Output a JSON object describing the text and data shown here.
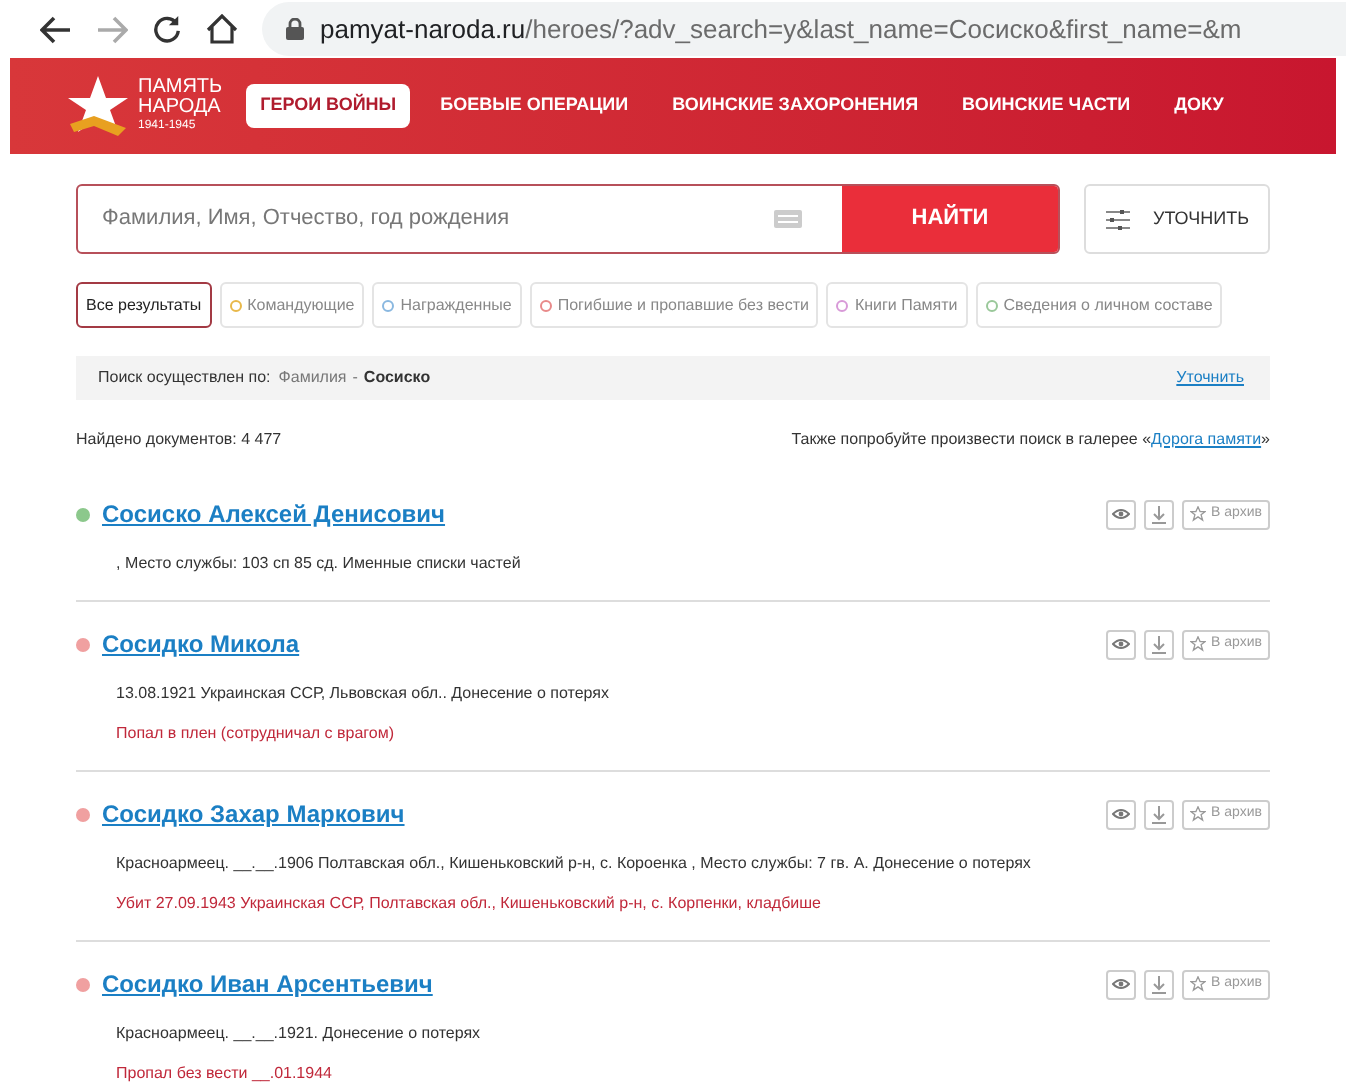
{
  "browser": {
    "url_host": "pamyat-naroda.ru",
    "url_path": "/heroes/?adv_search=y&last_name=Сосиско&first_name=&m"
  },
  "logo": {
    "line1": "ПАМЯТЬ",
    "line2": "НАРОДА",
    "years": "1941-1945"
  },
  "nav": [
    {
      "label": "ГЕРОИ ВОЙНЫ",
      "selected": true
    },
    {
      "label": "БОЕВЫЕ ОПЕРАЦИИ",
      "selected": false
    },
    {
      "label": "ВОИНСКИЕ ЗАХОРОНЕНИЯ",
      "selected": false
    },
    {
      "label": "ВОИНСКИЕ ЧАСТИ",
      "selected": false
    },
    {
      "label": "ДОКУ",
      "selected": false
    }
  ],
  "search": {
    "placeholder": "Фамилия, Имя, Отчество, год рождения",
    "button": "НАЙТИ",
    "refine": "УТОЧНИТЬ"
  },
  "filters": [
    {
      "label": "Все результаты",
      "selected": true
    },
    {
      "label": "Командующие",
      "selected": false,
      "color": "#e8b84a"
    },
    {
      "label": "Награжденные",
      "selected": false,
      "color": "#8ab8e0"
    },
    {
      "label": "Погибшие и пропавшие без вести",
      "selected": false,
      "color": "#e88a8a"
    },
    {
      "label": "Книги Памяти",
      "selected": false,
      "color": "#d89ad8"
    },
    {
      "label": "Сведения о личном составе",
      "selected": false,
      "color": "#9ac89a"
    }
  ],
  "query_bar": {
    "label": "Поиск осуществлен по:",
    "field": "Фамилия",
    "separator": "-",
    "value": "Сосиско",
    "link": "Уточнить"
  },
  "found": "Найдено документов: 4 477",
  "gallery_hint": {
    "text": "Также попробуйте произвести поиск в галерее «",
    "link": "Дорога памяти",
    "close": "»"
  },
  "results": [
    {
      "name": "Сосиско Алексей Денисович",
      "color": "#8cc88c",
      "details": ", Место службы: 103 сп 85 сд. Именные списки частей",
      "archive": "В архив"
    },
    {
      "name": "Сосидко Микола",
      "color": "#f0a0a0",
      "details": "13.08.1921 Украинская ССР, Львовская обл.. Донесение о потерях",
      "status": "Попал в плен (сотрудничал с врагом)",
      "archive": "В архив"
    },
    {
      "name": "Сосидко Захар Маркович",
      "color": "#f0a0a0",
      "details": "Красноармеец. __.__.1906 Полтавская обл., Кишеньковский р-н, с. Короенка , Место службы: 7 гв. А. Донесение о потерях",
      "status": "Убит 27.09.1943 Украинская ССР, Полтавская обл., Кишеньковский р-н, с. Корпенки, кладбише",
      "archive": "В архив"
    },
    {
      "name": "Сосидко Иван Арсентьевич",
      "color": "#f0a0a0",
      "details": "Красноармеец. __.__.1921. Донесение о потерях",
      "status": "Пропал без вести __.01.1944",
      "archive": "В архив"
    }
  ]
}
